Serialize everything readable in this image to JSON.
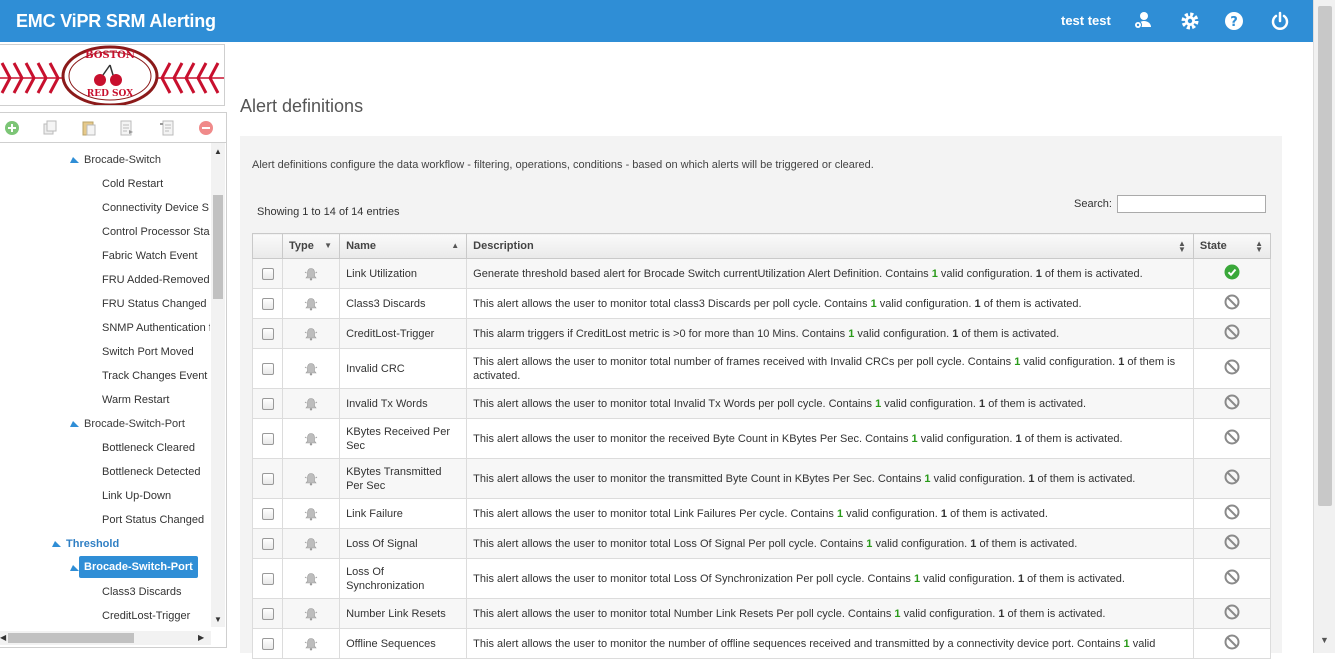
{
  "header": {
    "app_title": "EMC ViPR SRM Alerting",
    "user_name": "test test",
    "icons": [
      "users-icon",
      "gear-icon",
      "help-icon",
      "power-icon"
    ],
    "bg_color": "#2f8ed6"
  },
  "logo": {
    "text_top": "BOSTON",
    "text_bottom": "RED SOX"
  },
  "toolbar": {
    "buttons": [
      "add-icon",
      "copy-icon",
      "paste-icon",
      "export-icon",
      "import-icon",
      "delete-icon"
    ]
  },
  "tree": {
    "items": [
      {
        "label": "Brocade-Switch",
        "level": 1,
        "expandable": true
      },
      {
        "label": "Cold Restart",
        "level": 2
      },
      {
        "label": "Connectivity Device S",
        "level": 2
      },
      {
        "label": "Control Processor Sta",
        "level": 2
      },
      {
        "label": "Fabric Watch Event",
        "level": 2
      },
      {
        "label": "FRU Added-Removed",
        "level": 2
      },
      {
        "label": "FRU Status Changed",
        "level": 2
      },
      {
        "label": "SNMP Authentication f",
        "level": 2
      },
      {
        "label": "Switch Port Moved",
        "level": 2
      },
      {
        "label": "Track Changes Event",
        "level": 2
      },
      {
        "label": "Warm Restart",
        "level": 2
      },
      {
        "label": "Brocade-Switch-Port",
        "level": 1,
        "expandable": true
      },
      {
        "label": "Bottleneck Cleared",
        "level": 2
      },
      {
        "label": "Bottleneck Detected",
        "level": 2
      },
      {
        "label": "Link Up-Down",
        "level": 2
      },
      {
        "label": "Port Status Changed",
        "level": 2
      },
      {
        "label": "Threshold",
        "level": 0,
        "expandable": true
      },
      {
        "label": "Brocade-Switch-Port",
        "level": 1,
        "expandable": true,
        "selected": true
      },
      {
        "label": "Class3 Discards",
        "level": 2
      },
      {
        "label": "CreditLost-Trigger",
        "level": 2
      }
    ]
  },
  "main": {
    "title": "Alert definitions",
    "intro": "Alert definitions configure the data workflow - filtering, operations, conditions - based on which alerts will be triggered or cleared.",
    "showing": "Showing 1 to 14 of 14 entries",
    "search_label": "Search:",
    "search_value": "",
    "columns": {
      "type": "Type",
      "name": "Name",
      "description": "Description",
      "state": "State"
    },
    "rows": [
      {
        "name": "Link Utilization",
        "pre": "Generate threshold based alert for Brocade Switch currentUtilization Alert Definition. Contains ",
        "valid": "1",
        "mid": " valid configuration. ",
        "active": "1",
        "post": " of them is activated.",
        "state": "active"
      },
      {
        "name": "Class3 Discards",
        "pre": "This alert allows the user to monitor total class3 Discards per poll cycle. Contains ",
        "valid": "1",
        "mid": " valid configuration. ",
        "active": "1",
        "post": " of them is activated.",
        "state": "inactive"
      },
      {
        "name": "CreditLost-Trigger",
        "pre": "This alarm triggers if CreditLost metric is >0 for more than 10 Mins. Contains ",
        "valid": "1",
        "mid": " valid configuration. ",
        "active": "1",
        "post": " of them is activated.",
        "state": "inactive"
      },
      {
        "name": "Invalid CRC",
        "pre": "This alert allows the user to monitor total number of frames received with Invalid CRCs per poll cycle. Contains ",
        "valid": "1",
        "mid": " valid configuration. ",
        "active": "1",
        "post": " of them is activated.",
        "state": "inactive"
      },
      {
        "name": "Invalid Tx Words",
        "pre": "This alert allows the user to monitor total Invalid Tx Words per poll cycle. Contains ",
        "valid": "1",
        "mid": " valid configuration. ",
        "active": "1",
        "post": " of them is activated.",
        "state": "inactive"
      },
      {
        "name": "KBytes Received Per Sec",
        "pre": "This alert allows the user to monitor the received Byte Count in KBytes Per Sec. Contains ",
        "valid": "1",
        "mid": " valid configuration. ",
        "active": "1",
        "post": " of them is activated.",
        "state": "inactive"
      },
      {
        "name": "KBytes Transmitted Per Sec",
        "pre": "This alert allows the user to monitor the transmitted Byte Count in KBytes Per Sec. Contains ",
        "valid": "1",
        "mid": " valid configuration. ",
        "active": "1",
        "post": " of them is activated.",
        "state": "inactive"
      },
      {
        "name": "Link Failure",
        "pre": "This alert allows the user to monitor total Link Failures Per cycle. Contains ",
        "valid": "1",
        "mid": " valid configuration. ",
        "active": "1",
        "post": " of them is activated.",
        "state": "inactive"
      },
      {
        "name": "Loss Of Signal",
        "pre": "This alert allows the user to monitor total Loss Of Signal Per poll cycle. Contains ",
        "valid": "1",
        "mid": " valid configuration. ",
        "active": "1",
        "post": " of them is activated.",
        "state": "inactive"
      },
      {
        "name": "Loss Of Synchronization",
        "pre": "This alert allows the user to monitor total Loss Of Synchronization Per poll cycle. Contains ",
        "valid": "1",
        "mid": " valid configuration. ",
        "active": "1",
        "post": " of them is activated.",
        "state": "inactive"
      },
      {
        "name": "Number Link Resets",
        "pre": "This alert allows the user to monitor total Number Link Resets Per poll cycle. Contains ",
        "valid": "1",
        "mid": " valid configuration. ",
        "active": "1",
        "post": " of them is activated.",
        "state": "inactive"
      },
      {
        "name": "Offline Sequences",
        "pre": "This alert allows the user to monitor the number of offline sequences received and transmitted by a connectivity device port. Contains ",
        "valid": "1",
        "mid": " valid",
        "active": "",
        "post": "",
        "state": "inactive"
      }
    ]
  }
}
